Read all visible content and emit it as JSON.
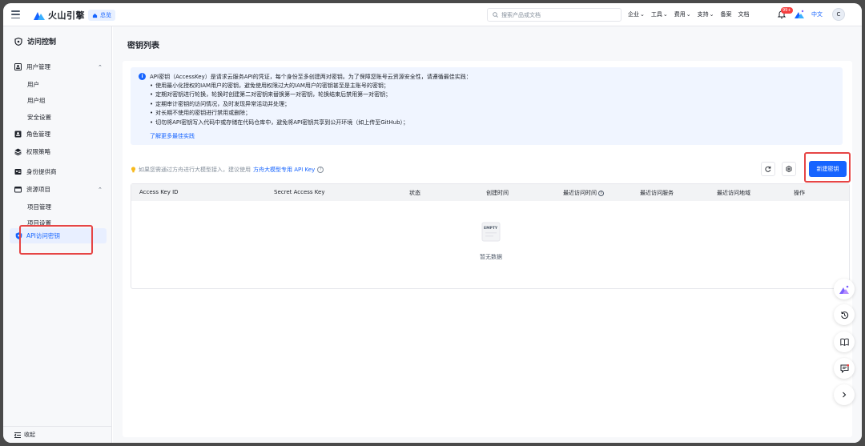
{
  "header": {
    "brand": "火山引擎",
    "home_label": "总览",
    "search_placeholder": "搜索产品或文档",
    "nav": [
      {
        "label": "企业",
        "dropdown": true
      },
      {
        "label": "工具",
        "dropdown": true
      },
      {
        "label": "费用",
        "dropdown": true
      },
      {
        "label": "支持",
        "dropdown": true
      },
      {
        "label": "备案",
        "dropdown": false
      },
      {
        "label": "文档",
        "dropdown": false
      }
    ],
    "notification_badge": "99+",
    "language": "中文",
    "avatar_letter": "C"
  },
  "sidebar": {
    "title": "访问控制",
    "groups": {
      "user_mgmt": {
        "label": "用户管理",
        "items": [
          "用户",
          "用户组",
          "安全设置"
        ]
      },
      "role_mgmt": {
        "label": "角色管理"
      },
      "policy": {
        "label": "权限策略"
      },
      "idp": {
        "label": "身份提供商"
      },
      "project": {
        "label": "资源项目",
        "items": [
          "项目管理",
          "项目设置"
        ]
      },
      "api_key": {
        "label": "API访问密钥"
      }
    },
    "collapse_label": "收起"
  },
  "main": {
    "page_title": "密钥列表",
    "notice": {
      "title": "API密钥（AccessKey）是请求云服务API的凭证，每个身份至多创建两对密钥。为了保障您账号云资源安全性，请遵循最佳实践：",
      "items": [
        "使用最小化授权的IAM用户的密钥，避免使用权限过大的IAM用户的密钥甚至是主账号的密钥；",
        "定期对密钥进行轮换，轮换时创建第二对密钥来替换第一对密钥，轮换结束后禁用第一对密钥；",
        "定期审计密钥的访问情况，及时发现异常活动并处理；",
        "对长期不使用的密钥进行禁用或删除；",
        "切勿将API密钥写入代码中或存储在代码仓库中，避免将API密钥共享到公开环境（如上传至GitHub）；"
      ],
      "link": "了解更多最佳实践"
    },
    "hint": {
      "text": "如果您需通过方舟进行大模型接入，建议使用",
      "link": "方舟大模型专用 API Key"
    },
    "create_button": "新建密钥",
    "table": {
      "columns": [
        "Access Key ID",
        "Secret Access Key",
        "状态",
        "创建时间",
        "最近访问时间",
        "最近访问服务",
        "最近访问地域",
        "操作"
      ],
      "rows": [],
      "empty_text": "暂无数据",
      "empty_label": "EMPTY"
    }
  },
  "colors": {
    "accent": "#1664ff",
    "highlight": "#e64545",
    "notice_bg": "#f0f5ff"
  }
}
